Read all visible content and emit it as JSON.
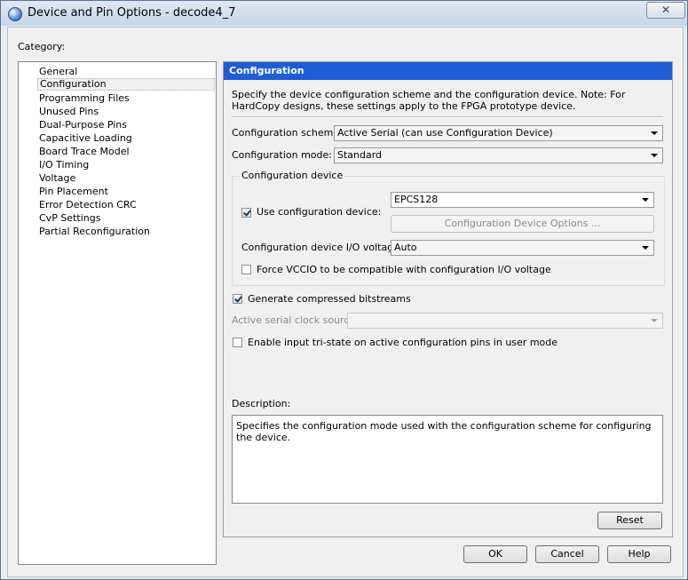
{
  "window": {
    "title": "Device and Pin Options - decode4_7",
    "close_glyph": "✕"
  },
  "category": {
    "label": "Category:",
    "items": [
      "General",
      "Configuration",
      "Programming Files",
      "Unused Pins",
      "Dual-Purpose Pins",
      "Capacitive Loading",
      "Board Trace Model",
      "I/O Timing",
      "Voltage",
      "Pin Placement",
      "Error Detection CRC",
      "CvP Settings",
      "Partial Reconfiguration"
    ],
    "selected": "Configuration"
  },
  "panel": {
    "header": "Configuration",
    "intro": "Specify the device configuration scheme and the configuration device. Note: For HardCopy designs, these settings apply to the FPGA prototype device.",
    "scheme_label": "Configuration scheme:",
    "scheme_value": "Active Serial (can use Configuration Device)",
    "mode_label": "Configuration mode:",
    "mode_value": "Standard",
    "config_device": {
      "group_title": "Configuration device",
      "use_label": "Use configuration device:",
      "use_checked": true,
      "device_value": "EPCS128",
      "options_button": "Configuration Device Options ...",
      "io_voltage_label": "Configuration device I/O voltage:",
      "io_voltage_value": "Auto",
      "force_vccio_label": "Force VCCIO to be compatible with configuration I/O voltage",
      "force_vccio_checked": false
    },
    "compressed_label": "Generate compressed bitstreams",
    "compressed_checked": true,
    "clock_source_label": "Active serial clock source:",
    "clock_source_value": "",
    "tristate_label": "Enable input tri-state on active configuration pins in user mode",
    "tristate_checked": false,
    "description_label": "Description:",
    "description_text": "Specifies the configuration mode used with the configuration scheme for configuring the device.",
    "reset_button": "Reset"
  },
  "footer": {
    "ok": "OK",
    "cancel": "Cancel",
    "help": "Help"
  }
}
